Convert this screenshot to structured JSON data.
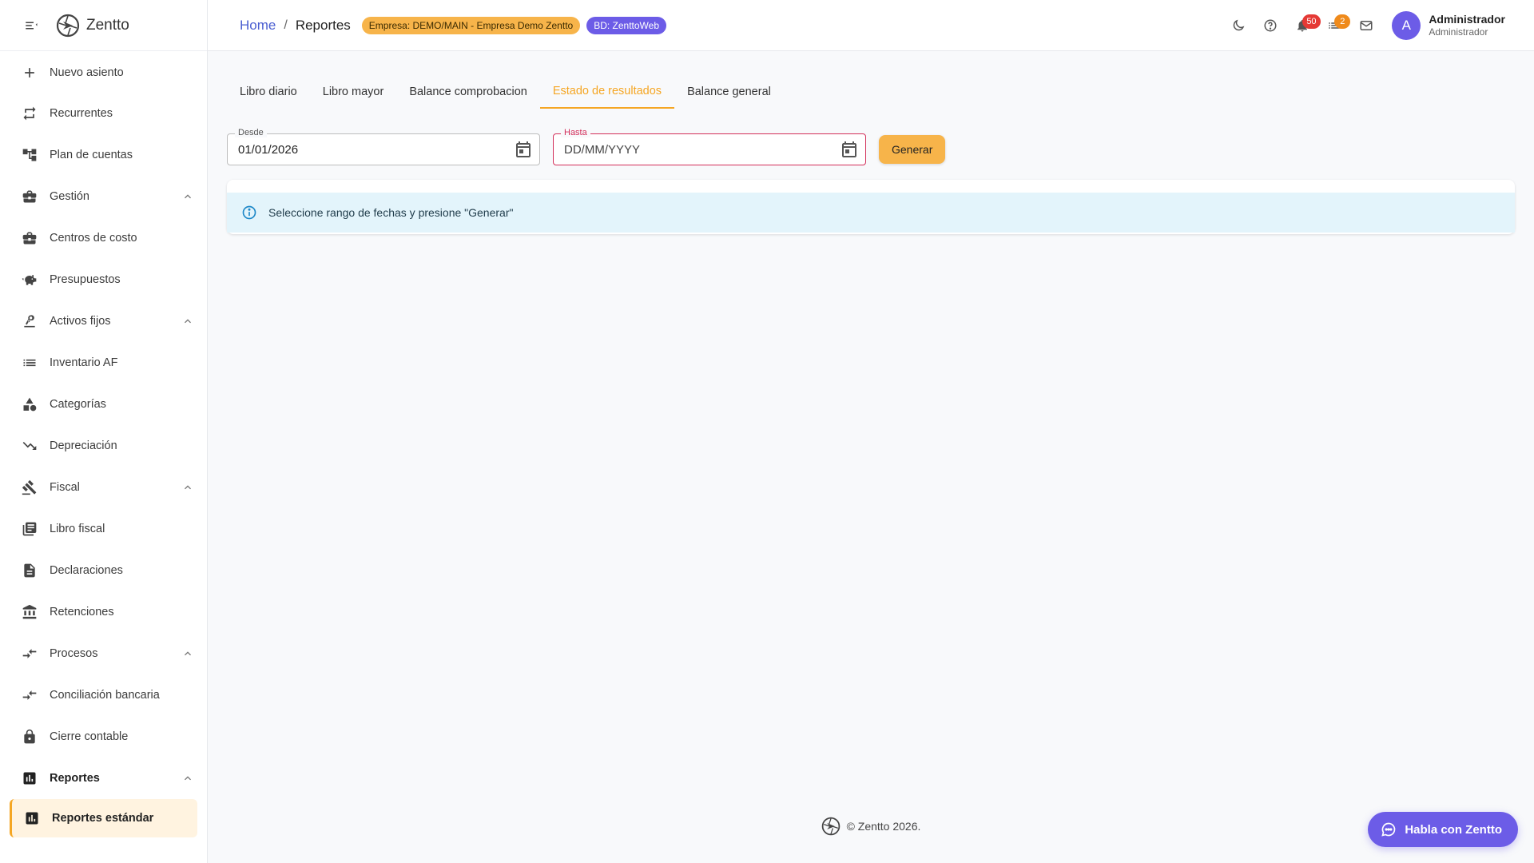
{
  "app": {
    "name": "Zentto"
  },
  "sidebar": {
    "items": [
      {
        "label": "Nuevo asiento",
        "icon": "plus-icon"
      },
      {
        "label": "Recurrentes",
        "icon": "repeat-icon"
      },
      {
        "label": "Plan de cuentas",
        "icon": "account-tree-icon"
      },
      {
        "label": "Gestión",
        "icon": "briefcase-icon",
        "expanded": true
      },
      {
        "label": "Centros de costo",
        "icon": "briefcase-icon"
      },
      {
        "label": "Presupuestos",
        "icon": "piggy-bank-icon"
      },
      {
        "label": "Activos fijos",
        "icon": "precision-tool-icon",
        "expanded": true
      },
      {
        "label": "Inventario AF",
        "icon": "list-icon"
      },
      {
        "label": "Categorías",
        "icon": "category-icon"
      },
      {
        "label": "Depreciación",
        "icon": "trending-down-icon"
      },
      {
        "label": "Fiscal",
        "icon": "gavel-icon",
        "expanded": true
      },
      {
        "label": "Libro fiscal",
        "icon": "book-icon"
      },
      {
        "label": "Declaraciones",
        "icon": "document-icon"
      },
      {
        "label": "Retenciones",
        "icon": "bank-icon"
      },
      {
        "label": "Procesos",
        "icon": "compare-arrows-icon",
        "expanded": true
      },
      {
        "label": "Conciliación bancaria",
        "icon": "compare-arrows-icon"
      },
      {
        "label": "Cierre contable",
        "icon": "lock-icon"
      },
      {
        "label": "Reportes",
        "icon": "bar-chart-icon",
        "expanded": true
      },
      {
        "label": "Reportes estándar",
        "icon": "bar-chart-icon",
        "active": true
      }
    ]
  },
  "header": {
    "breadcrumb": {
      "home": "Home",
      "separator": "/",
      "current": "Reportes"
    },
    "empresa_badge": "Empresa: DEMO/MAIN - Empresa Demo Zentto",
    "bd_badge": "BD: ZenttoWeb",
    "notifications_count": "50",
    "tasks_count": "2",
    "user": {
      "initial": "A",
      "name": "Administrador",
      "role": "Administrador"
    }
  },
  "tabs": [
    {
      "label": "Libro diario"
    },
    {
      "label": "Libro mayor"
    },
    {
      "label": "Balance comprobacion"
    },
    {
      "label": "Estado de resultados",
      "active": true
    },
    {
      "label": "Balance general"
    }
  ],
  "filters": {
    "desde": {
      "label": "Desde",
      "value": "01/01/2026"
    },
    "hasta": {
      "label": "Hasta",
      "placeholder": "DD/MM/YYYY"
    },
    "generate_label": "Generar"
  },
  "alert": {
    "message": "Seleccione rango de fechas y presione \"Generar\""
  },
  "footer": {
    "copyright": "© Zentto 2026."
  },
  "chat": {
    "label": "Habla con Zentto"
  },
  "colors": {
    "accent": "#f5a623",
    "brand": "#6c5ce7",
    "link": "#4b5fd1",
    "info_bg": "#e3f4fb",
    "error": "#d32f5a"
  }
}
